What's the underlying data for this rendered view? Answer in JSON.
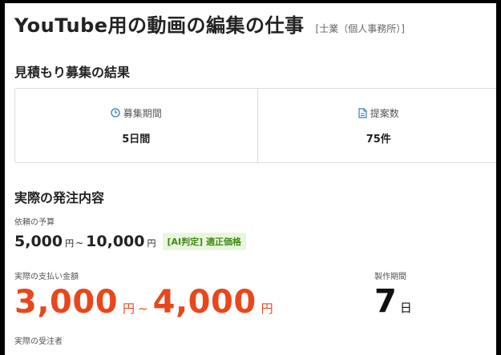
{
  "header": {
    "title": "YouTube用の動画の編集の仕事",
    "category": "[士業（個人事務所）]"
  },
  "quote_results": {
    "heading": "見積もり募集の結果",
    "period": {
      "label": "募集期間",
      "value": "5日間",
      "icon": "clock-icon"
    },
    "proposals": {
      "label": "提案数",
      "value": "75件",
      "icon": "document-icon"
    }
  },
  "order": {
    "heading": "実際の発注内容",
    "budget": {
      "label": "依頼の予算",
      "min": "5,000",
      "max": "10,000",
      "unit": "円",
      "separator": "~",
      "ai_badge": "[AI判定] 適正価格"
    },
    "payment": {
      "label": "実際の支払い金額",
      "min": "3,000",
      "max": "4,000",
      "unit": "円",
      "separator": "~"
    },
    "production_period": {
      "label": "製作期間",
      "value": "7",
      "unit": "日"
    },
    "contractor_label": "実際の受注者"
  },
  "colors": {
    "accent_price": "#e8471d",
    "badge_bg": "#e9f6df",
    "badge_text": "#3f8a12",
    "icon_blue": "#2b7ec1"
  }
}
